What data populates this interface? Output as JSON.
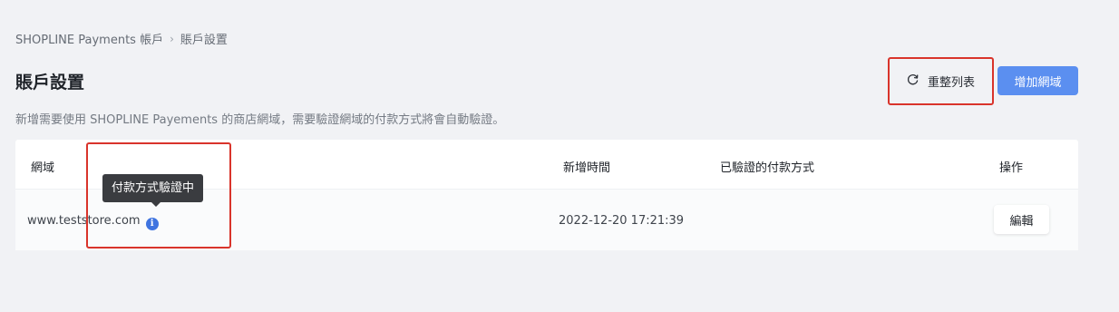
{
  "breadcrumb": {
    "root": "SHOPLINE Payments 帳戶",
    "separator": "›",
    "current": "賬戶設置"
  },
  "page": {
    "title": "賬戶設置",
    "description": "新增需要使用 SHOPLINE Payements 的商店網域，需要驗證網域的付款方式將會自動驗證。"
  },
  "toolbar": {
    "refresh_label": "重整列表",
    "add_domain_label": "增加網域"
  },
  "table": {
    "columns": [
      "網域",
      "新增時間",
      "已驗證的付款方式",
      "操作"
    ],
    "rows": [
      {
        "domain": "www.teststore.com",
        "info_icon": "i",
        "created_at": "2022-12-20 17:21:39",
        "verified_methods": "",
        "action_label": "編輯"
      }
    ]
  },
  "tooltip": {
    "text": "付款方式驗證中"
  },
  "colors": {
    "primary": "#5b8ff0",
    "highlight": "#d9342b",
    "info": "#3f74e0",
    "background": "#f1f2f5"
  },
  "icons": {
    "refresh": "refresh-icon",
    "info": "info-icon"
  }
}
